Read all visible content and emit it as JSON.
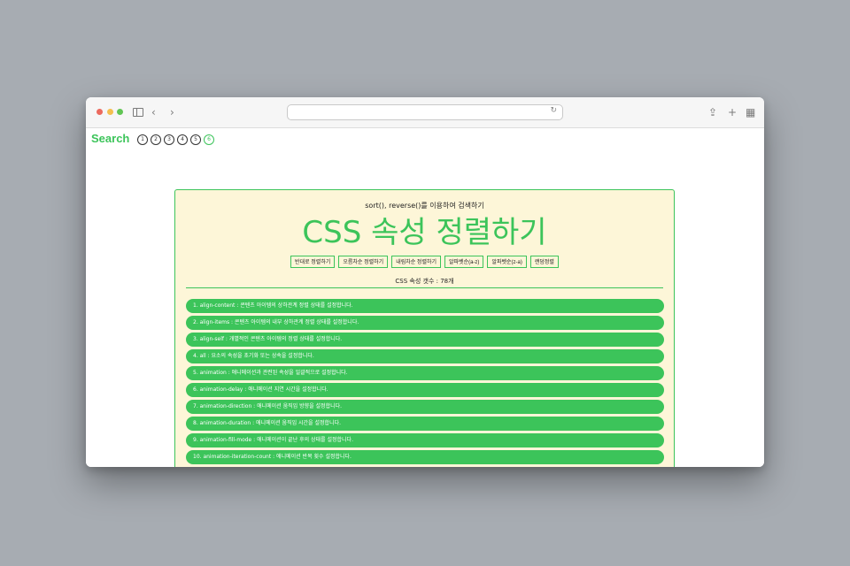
{
  "browser": {
    "address_text": ""
  },
  "header": {
    "search_title": "Search",
    "pages": [
      "1",
      "2",
      "3",
      "4",
      "5",
      "6"
    ],
    "active_page": "6"
  },
  "card": {
    "subtitle": "sort(), reverse()를 이용하여 검색하기",
    "title": "CSS 속성 정렬하기",
    "buttons": [
      "반대로 정렬하기",
      "오름차순 정렬하기",
      "내림차순 정렬하기",
      "알파벳순(a-z)",
      "알파벳순(z-a)",
      "랜덤정렬"
    ],
    "count_text": "CSS 속성 갯수 : 78개"
  },
  "list": [
    "1. align-content : 콘텐츠 아이템의 상하관계 정렬 상태를 설정합니다.",
    "2. align-items : 콘텐츠 아이템의 내부 상하관계 정렬 상태를 설정합니다.",
    "3. align-self : 개별적인 콘텐츠 아이템의 정렬 상태를 설정합니다.",
    "4. all : 요소의 속성을 초기화 또는 상속을 설정합니다.",
    "5. animation : 애니메이션과 관련된 속성을 일괄적으로 설정합니다.",
    "6. animation-delay : 애니메이션 지연 시간을 설정합니다.",
    "7. animation-direction : 애니메이션 움직임 방향을 설정합니다.",
    "8. animation-duration : 애니메이션 움직임 시간을 설정합니다.",
    "9. animation-fill-mode : 애니메이션이 끝난 후의 상태를 설정합니다.",
    "10. animation-iteration-count : 애니메이션 반복 횟수 설정합니다."
  ],
  "colors": {
    "accent": "#3cc45a",
    "card_bg": "#fdf6d8"
  }
}
